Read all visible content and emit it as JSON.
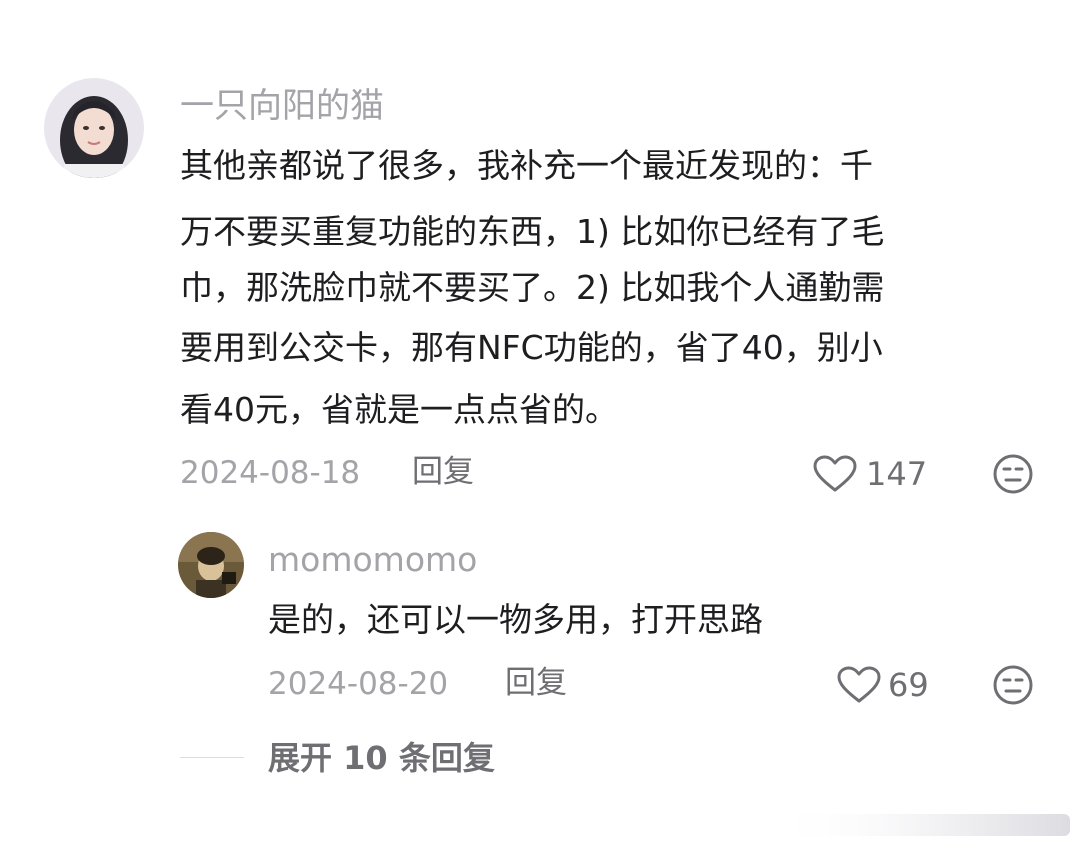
{
  "comment": {
    "username": "一只向阳的猫",
    "lines": [
      "其他亲都说了很多，我补充一个最近发现的：千",
      "万不要买重复功能的东西，1) 比如你已经有了毛",
      "巾，那洗脸巾就不要买了。2) 比如我个人通勤需",
      "要用到公交卡，那有NFC功能的，省了40，别小",
      "看40元，省就是一点点省的。"
    ],
    "date": "2024-08-18",
    "reply_label": "回复",
    "like_count": "147",
    "like_icon": "heart-outline-icon",
    "dislike_icon": "neutral-face-icon"
  },
  "reply": {
    "username": "momomomo",
    "text": "是的，还可以一物多用，打开思路",
    "date": "2024-08-20",
    "reply_label": "回复",
    "like_count": "69",
    "like_icon": "heart-outline-icon",
    "dislike_icon": "neutral-face-icon"
  },
  "expand": {
    "label": "展开 10 条回复"
  },
  "colors": {
    "background": "#ffffff",
    "text": "#1e1e20",
    "muted": "#a3a3a8",
    "secondary": "#6e6e73"
  }
}
